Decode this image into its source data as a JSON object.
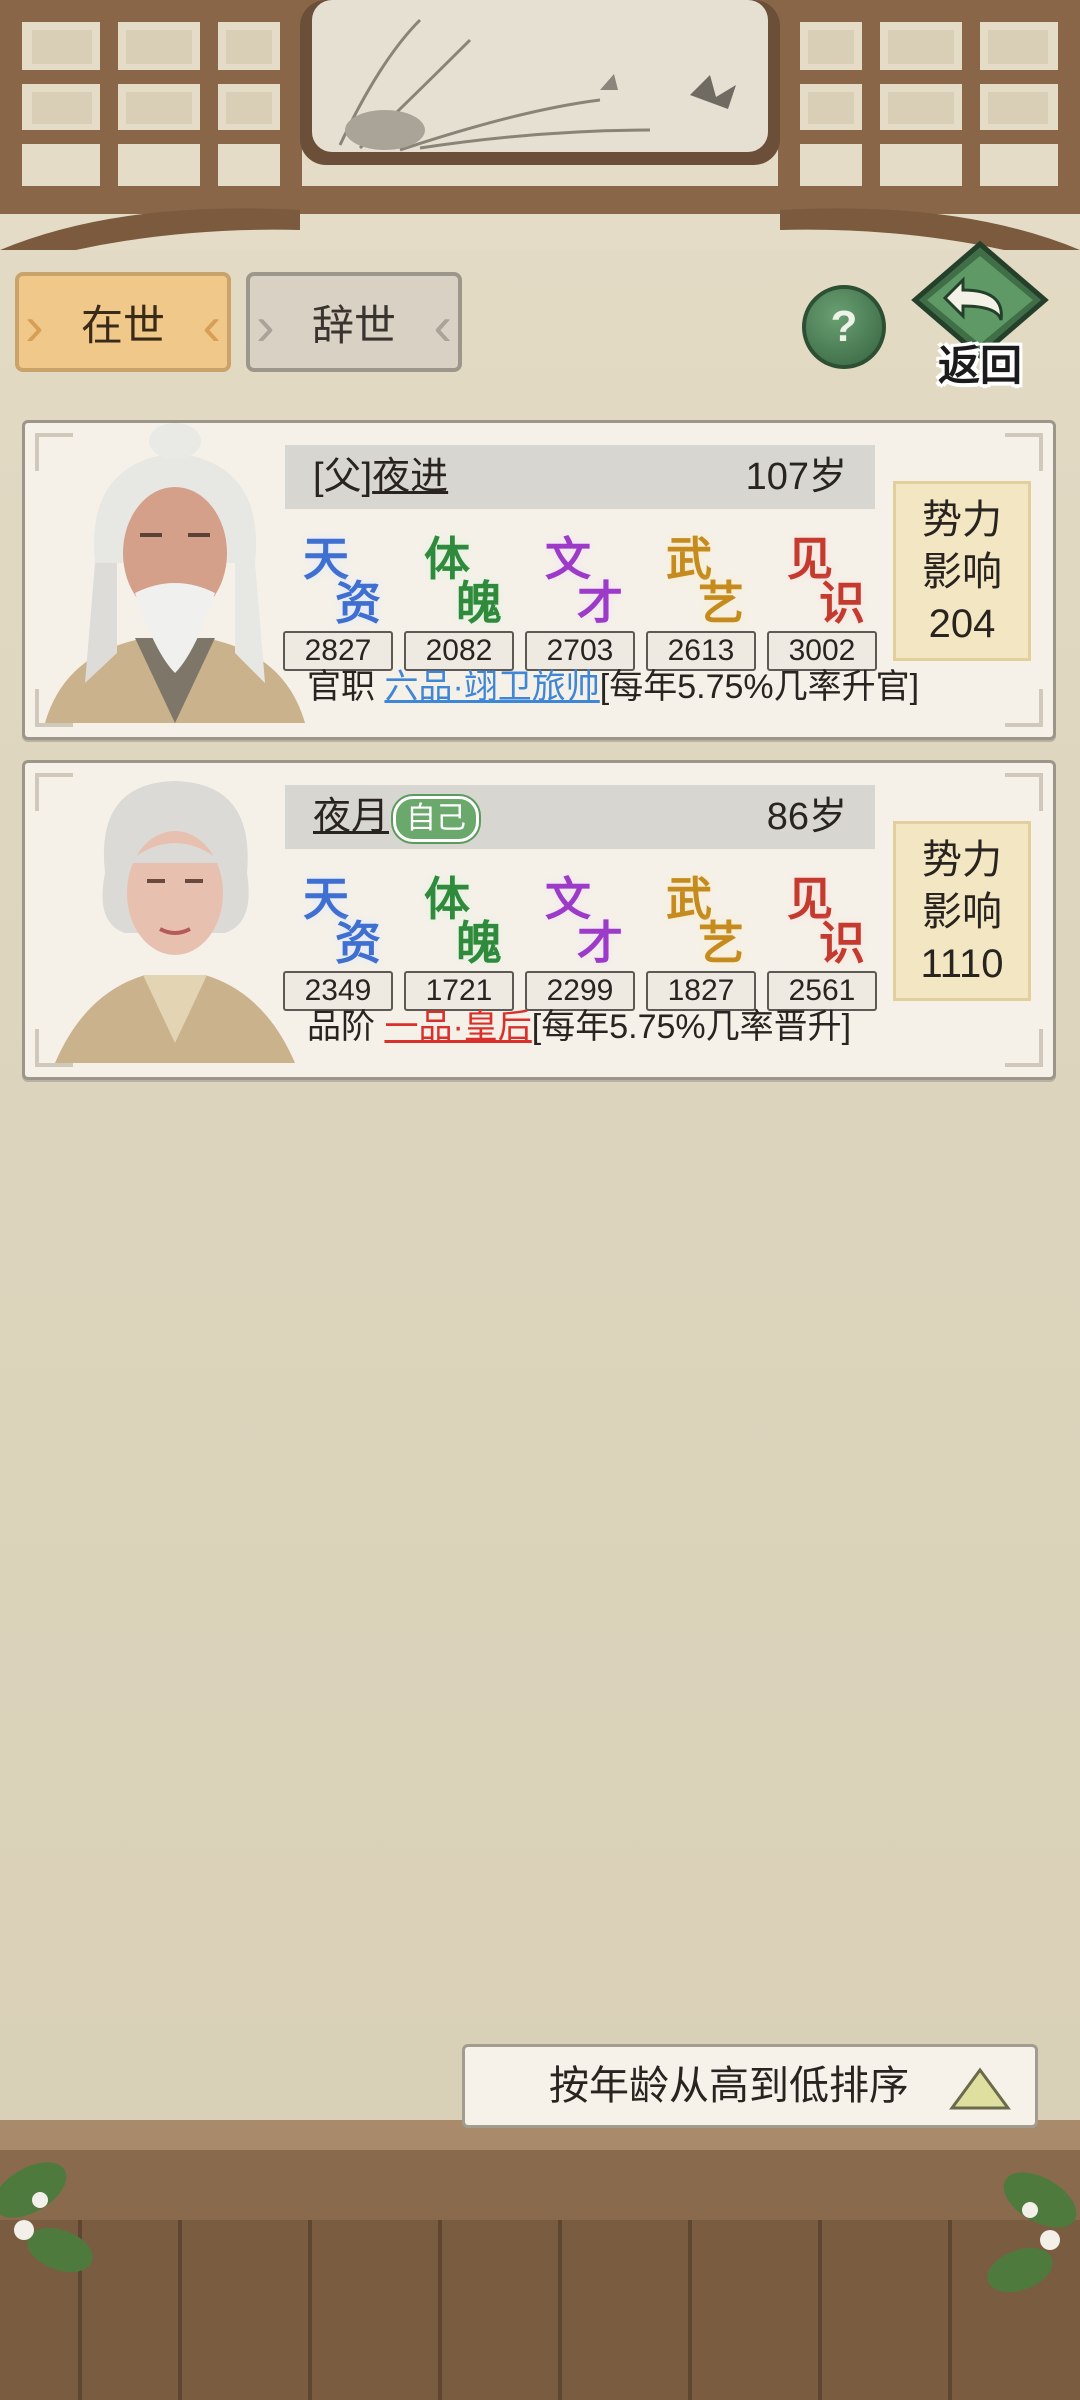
{
  "tabs": [
    {
      "label": "在世",
      "selected": true
    },
    {
      "label": "辞世",
      "selected": false
    }
  ],
  "top_buttons": {
    "help_label": "?",
    "back_label": "返回"
  },
  "stat_names": [
    {
      "chars": [
        "天",
        "资"
      ],
      "color": "#3e6fd1"
    },
    {
      "chars": [
        "体",
        "魄"
      ],
      "color": "#2f8a3c"
    },
    {
      "chars": [
        "文",
        "才"
      ],
      "color": "#9b3bc7"
    },
    {
      "chars": [
        "武",
        "艺"
      ],
      "color": "#c58b1e"
    },
    {
      "chars": [
        "见",
        "识"
      ],
      "color": "#c53a2f"
    }
  ],
  "people": [
    {
      "relation": "[父]",
      "name": "夜进",
      "self_badge": "",
      "age": "107岁",
      "stats": [
        "2827",
        "2082",
        "2703",
        "2613",
        "3002"
      ],
      "influence_label_1": "势力",
      "influence_label_2": "影响",
      "influence_value": "204",
      "title_label": "官职",
      "title_value": "六品·翊卫旅帅",
      "title_note": "[每年5.75%几率升官]"
    },
    {
      "relation": "",
      "name": "夜月",
      "self_badge": "自己",
      "age": "86岁",
      "stats": [
        "2349",
        "1721",
        "2299",
        "1827",
        "2561"
      ],
      "influence_label_1": "势力",
      "influence_label_2": "影响",
      "influence_value": "1110",
      "title_label": "品阶",
      "title_value": "一品·皇后",
      "title_note": "[每年5.75%几率晋升]"
    }
  ],
  "sort": {
    "label": "按年龄从高到低排序",
    "direction": "descending"
  }
}
